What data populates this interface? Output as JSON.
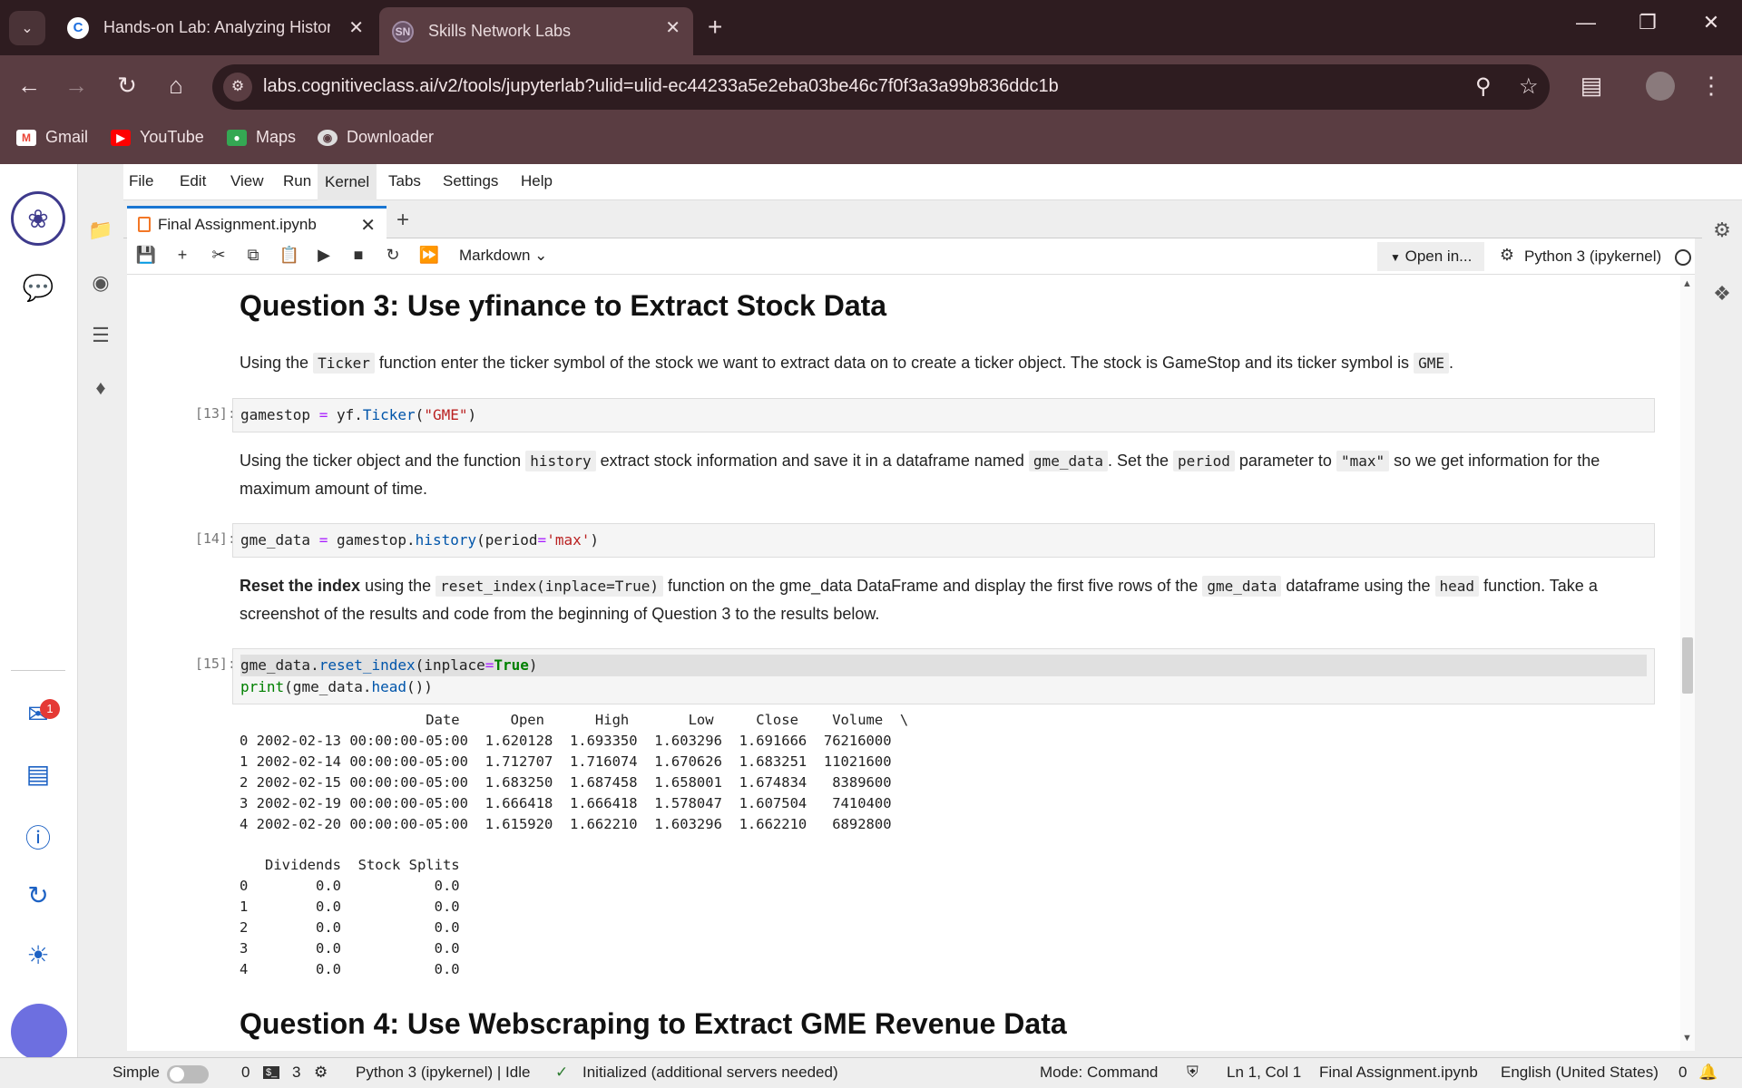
{
  "browser": {
    "tabs": [
      {
        "title": "Hands-on Lab: Analyzing Histor",
        "favicon": "C"
      },
      {
        "title": "Skills Network Labs",
        "favicon": "SN"
      }
    ],
    "url": "labs.cognitiveclass.ai/v2/tools/jupyterlab?ulid=ulid-ec44233a5e2eba03be46c7f0f3a3a99b836ddc1b",
    "bookmarks": [
      {
        "label": "Gmail",
        "icon": "gmail-icon",
        "color": "#ea4335"
      },
      {
        "label": "YouTube",
        "icon": "youtube-icon",
        "color": "#ff0000"
      },
      {
        "label": "Maps",
        "icon": "maps-icon",
        "color": "#34a853"
      },
      {
        "label": "Downloader",
        "icon": "globe-icon",
        "color": "#dddddd"
      }
    ]
  },
  "jupyter": {
    "menu": [
      "File",
      "Edit",
      "View",
      "Run",
      "Kernel",
      "Tabs",
      "Settings",
      "Help"
    ],
    "active_menu": "Kernel",
    "doc_tab": "Final Assignment.ipynb",
    "cell_type": "Markdown",
    "open_in": "Open in...",
    "kernel": "Python 3 (ipykernel)",
    "rail_badge": "1"
  },
  "notebook": {
    "q3_heading": "Question 3: Use yfinance to Extract Stock Data",
    "q3_text": {
      "a": "Using the",
      "code1": "Ticker",
      "b": "function enter the ticker symbol of the stock we want to extract data on to create a ticker object. The stock is GameStop and its ticker symbol is",
      "code2": "GME",
      "c": "."
    },
    "cell13": {
      "prompt": "[13]:"
    },
    "hist_text": {
      "a": "Using the ticker object and the function",
      "code1": "history",
      "b": "extract stock information and save it in a dataframe named",
      "code2": "gme_data",
      "c": ". Set the",
      "code3": "period",
      "d": "parameter to",
      "code4": "\"max\"",
      "e": "so we get information for the maximum amount of time."
    },
    "cell14": {
      "prompt": "[14]:"
    },
    "reset_text": {
      "bold": "Reset the index",
      "a": "using the",
      "code1": "reset_index(inplace=True)",
      "b": "function on the gme_data DataFrame and display the first five rows of the",
      "code2": "gme_data",
      "c": "dataframe using the",
      "code3": "head",
      "d": "function. Take a screenshot of the results and code from the beginning of Question 3 to the results below."
    },
    "cell15": {
      "prompt": "[15]:"
    },
    "output_table1": {
      "header": "                      Date      Open      High       Low     Close    Volume  \\",
      "rows": [
        "0 2002-02-13 00:00:00-05:00  1.620128  1.693350  1.603296  1.691666  76216000",
        "1 2002-02-14 00:00:00-05:00  1.712707  1.716074  1.670626  1.683251  11021600",
        "2 2002-02-15 00:00:00-05:00  1.683250  1.687458  1.658001  1.674834   8389600",
        "3 2002-02-19 00:00:00-05:00  1.666418  1.666418  1.578047  1.607504   7410400",
        "4 2002-02-20 00:00:00-05:00  1.615920  1.662210  1.603296  1.662210   6892800"
      ]
    },
    "output_table2": {
      "header": "   Dividends  Stock Splits",
      "rows": [
        "0        0.0           0.0",
        "1        0.0           0.0",
        "2        0.0           0.0",
        "3        0.0           0.0",
        "4        0.0           0.0"
      ]
    },
    "q4_heading": "Question 4: Use Webscraping to Extract GME Revenue Data"
  },
  "statusbar": {
    "mode_label": "Simple",
    "terminals": "0",
    "kernels": "3",
    "kernel_status": "Python 3 (ipykernel) | Idle",
    "lsp": "Initialized (additional servers needed)",
    "mode": "Mode: Command",
    "position": "Ln 1, Col 1",
    "file": "Final Assignment.ipynb",
    "language": "English (United States)",
    "notifications": "0"
  }
}
